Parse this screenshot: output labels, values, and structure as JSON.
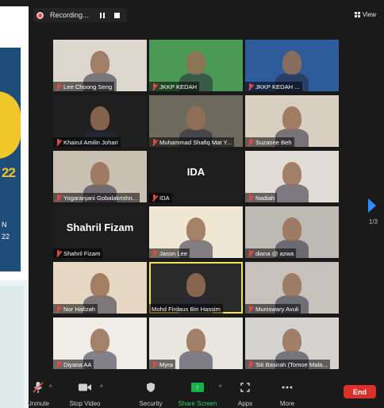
{
  "background": {
    "slide_lines": [
      "22",
      "N",
      "22"
    ]
  },
  "recording": {
    "label": "Recording..."
  },
  "view": {
    "label": "View"
  },
  "participants": [
    {
      "name": "Lee Choong Seng",
      "bg": "#dcd7cc",
      "muted": true
    },
    {
      "name": "JKKP KEDAH",
      "bg": "#4a9a55",
      "muted": true
    },
    {
      "name": "JKKP KEDAH ...",
      "bg": "#2e5c9a",
      "muted": true
    },
    {
      "name": "Khairul Amilin Johari",
      "bg": "#202020",
      "muted": true
    },
    {
      "name": "Muhammad Shafiq Mat Y...",
      "bg": "#6e6a5e",
      "muted": true
    },
    {
      "name": "Suzanne Beh",
      "bg": "#d9cfc0",
      "muted": true
    },
    {
      "name": "Yogaranjani Gobalakrishn...",
      "bg": "#c9bfb2",
      "muted": true
    },
    {
      "name": "IDA",
      "bg": "#1e1e1e",
      "muted": true,
      "text": "IDA"
    },
    {
      "name": "Nadiah",
      "bg": "#e2dcd6",
      "muted": true
    },
    {
      "name": "Shahril Fizam",
      "bg": "#1e1e1e",
      "muted": true,
      "text": "Shahril Fizam"
    },
    {
      "name": "Jason Lee",
      "bg": "#efe7d4",
      "muted": true
    },
    {
      "name": "diana @ azwa",
      "bg": "#bdbab3",
      "muted": true
    },
    {
      "name": "Nor Hafizah",
      "bg": "#e7d8c4",
      "muted": true
    },
    {
      "name": "Mohd Firdaus Bin Hassim",
      "bg": "#2a2a2a",
      "muted": false,
      "active": true
    },
    {
      "name": "Muniswary Avuli",
      "bg": "#c6c1ba",
      "muted": true
    },
    {
      "name": "Diyana AA",
      "bg": "#f0ece6",
      "muted": true
    },
    {
      "name": "Myra",
      "bg": "#e9e6df",
      "muted": true
    },
    {
      "name": "Siti Basirah (Tomoe Mala...",
      "bg": "#d5d3cf",
      "muted": true
    }
  ],
  "pagination": {
    "label": "1/3"
  },
  "toolbar": {
    "unmute": "Unmute",
    "stop_video": "Stop Video",
    "security": "Security",
    "share_screen": "Share Screen",
    "apps": "Apps",
    "more": "More",
    "end": "End"
  },
  "colors": {
    "accent": "#2d8cff",
    "end": "#d9302c",
    "share": "#17b34a",
    "active_border": "#f3e35a"
  }
}
